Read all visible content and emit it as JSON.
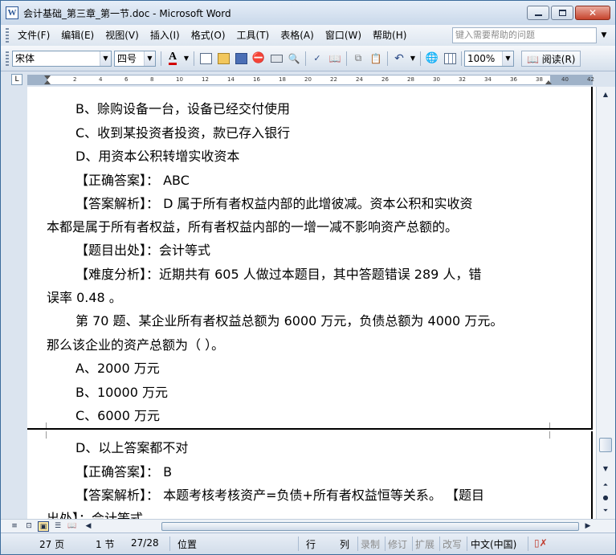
{
  "window": {
    "title": "会计基础_第三章_第一节.doc - Microsoft Word",
    "app_icon": "W",
    "minimize_icon": "minimize-icon",
    "maximize_icon": "maximize-icon",
    "close_glyph": "✕"
  },
  "menu": {
    "items": [
      "文件(F)",
      "编辑(E)",
      "视图(V)",
      "插入(I)",
      "格式(O)",
      "工具(T)",
      "表格(A)",
      "窗口(W)",
      "帮助(H)"
    ],
    "help_placeholder": "键入需要帮助的问题"
  },
  "toolbar": {
    "font_name": "宋体",
    "font_size": "四号",
    "font_color_label": "A",
    "zoom": "100%",
    "read_label": "阅读(R)",
    "icons": [
      "new-doc-icon",
      "open-folder-icon",
      "save-icon",
      "permission-icon",
      "print-icon",
      "print-preview-icon",
      "spelling-icon",
      "research-icon",
      "copy-icon",
      "paste-icon",
      "undo-icon",
      "hyperlink-icon",
      "table-icon"
    ]
  },
  "ruler": {
    "ticks": [
      "2",
      "4",
      "6",
      "8",
      "10",
      "12",
      "14",
      "16",
      "18",
      "20",
      "22",
      "24",
      "26",
      "28",
      "30",
      "32",
      "34",
      "36",
      "38",
      "40",
      "42"
    ]
  },
  "document": {
    "page1_lines": [
      "B、赊购设备一台，设备已经交付使用",
      "C、收到某投资者投资，款已存入银行",
      "D、用资本公积转增实收资本",
      "【正确答案】： ABC",
      "【答案解析】： D 属于所有者权益内部的此增彼减。资本公积和实收资",
      "本都是属于所有者权益，所有者权益内部的一增一减不影响资产总额的。",
      "【题目出处】：会计等式",
      "【难度分析】：近期共有 605 人做过本题目，其中答题错误 289 人，错",
      "误率 0.48 。",
      "第 70 题、某企业所有者权益总额为 6000 万元，负债总额为 4000 万元。",
      "那么该企业的资产总额为（ ）。",
      "A、2000 万元",
      "B、10000 万元",
      "C、6000 万元"
    ],
    "page2_lines": [
      "D、以上答案都不对",
      "【正确答案】： B",
      "【答案解析】： 本题考核考核资产=负债+所有者权益恒等关系。 【题目",
      "出处】：会计等式"
    ]
  },
  "statusbar": {
    "page": "27 页",
    "section": "1 节",
    "page_of": "27/28",
    "position": "位置",
    "line": "行",
    "column": "列",
    "rec": "录制",
    "trk": "修订",
    "ext": "扩展",
    "ovr": "改写",
    "language": "中文(中国)"
  }
}
